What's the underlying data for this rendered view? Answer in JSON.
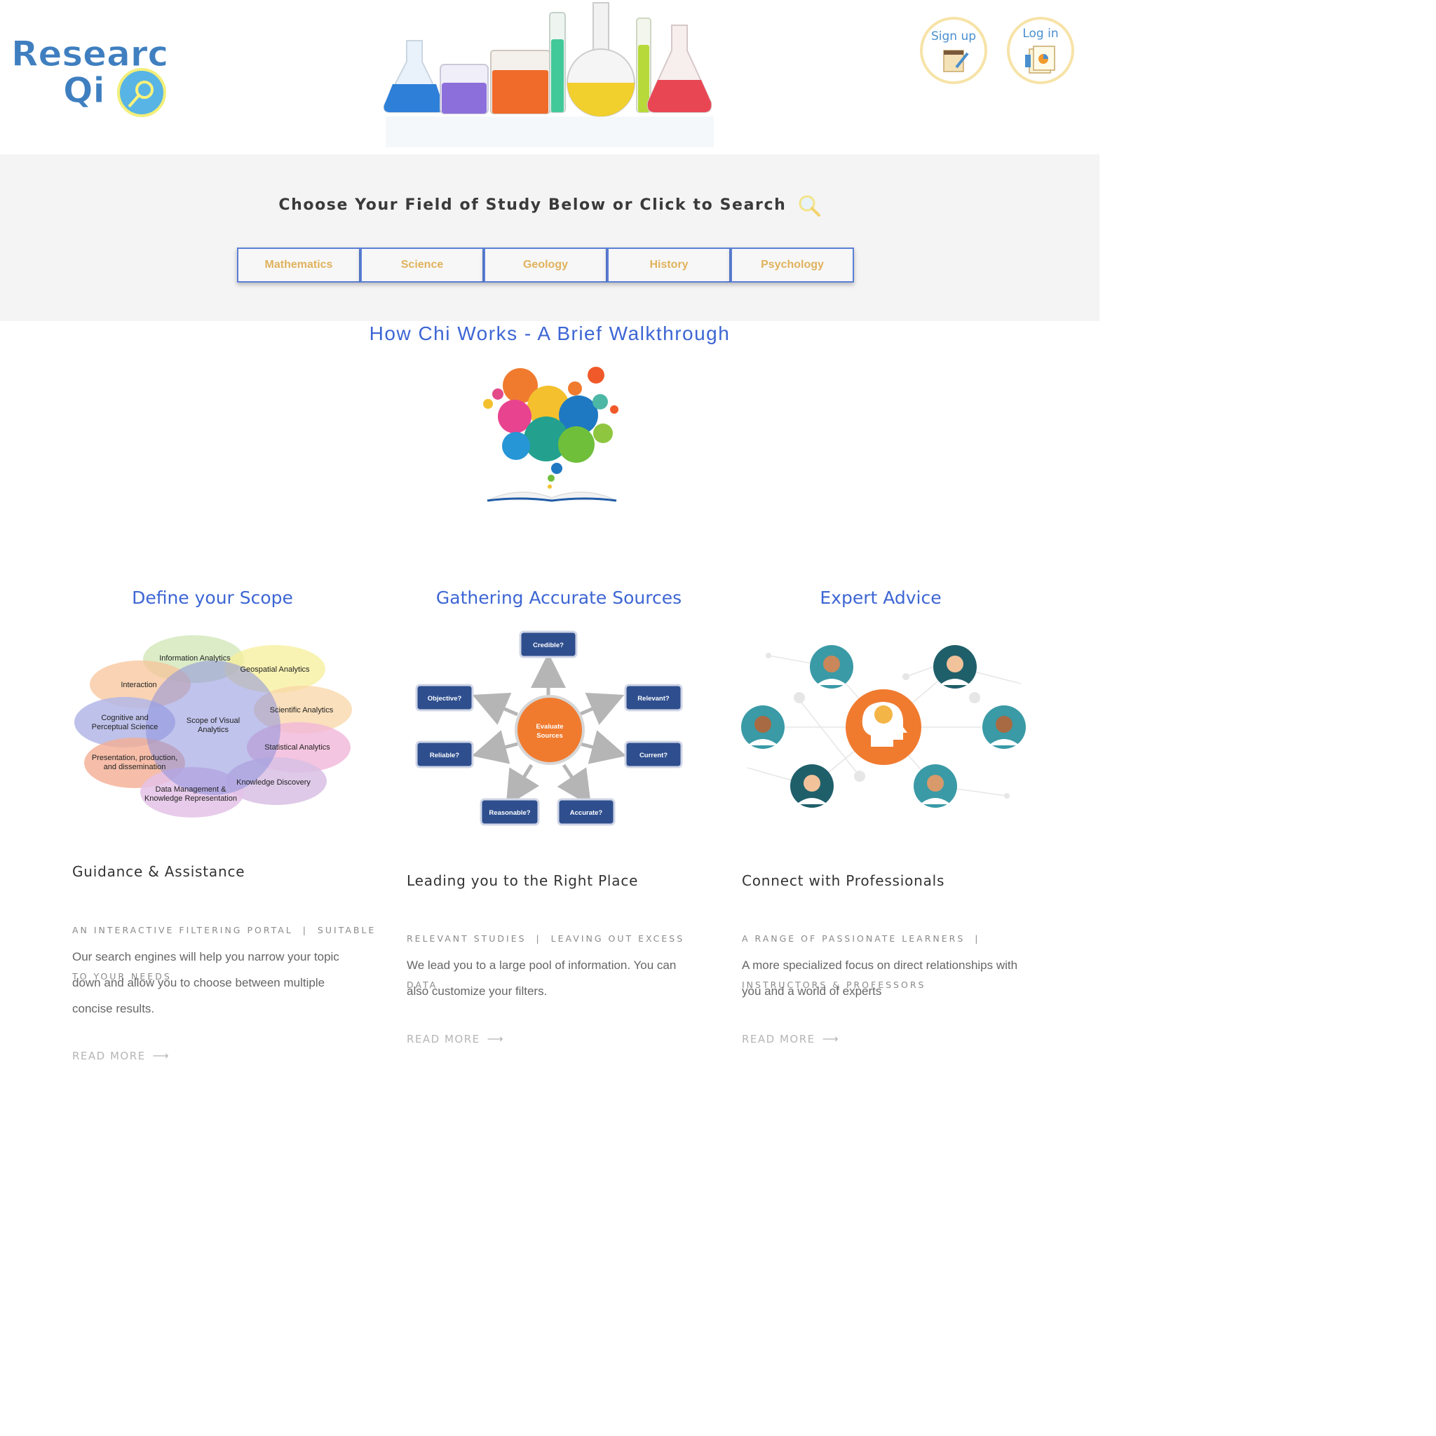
{
  "brand": {
    "line1": "Research",
    "line2": "Qi"
  },
  "auth": {
    "signup_label": "Sign up",
    "login_label": "Log in"
  },
  "field_section": {
    "heading": "Choose Your Field of Study Below or Click to Search",
    "fields": [
      "Mathematics",
      "Science",
      "Geology",
      "History",
      "Psychology"
    ]
  },
  "walkthrough": {
    "title": "How Chi Works - A Brief Walkthrough"
  },
  "features": [
    {
      "title": "Define your Scope",
      "heading": "Guidance & Assistance",
      "tags_line1": "AN INTERACTIVE FILTERING PORTAL  |  SUITABLE",
      "tags_line2": "TO YOUR NEEDS",
      "desc_lines": [
        "Our search engines will help you narrow your topic",
        "down and allow you to choose between multiple",
        "concise results."
      ],
      "read_more": "READ MORE",
      "diagram": {
        "center": [
          "Scope of Visual",
          "Analytics"
        ],
        "petals": [
          "Information Analytics",
          "Geospatial Analytics",
          "Interaction",
          "Scientific Analytics",
          "Cognitive and",
          "Perceptual Science",
          "Statistical Analytics",
          "Presentation, production,",
          "and dissemination",
          "Knowledge Discovery",
          "Data Management &",
          "Knowledge Representation"
        ]
      }
    },
    {
      "title": "Gathering Accurate Sources",
      "heading": "Leading you to the Right Place",
      "tags_line1": "RELEVANT STUDIES  |  LEAVING OUT EXCESS",
      "tags_line2": "DATA",
      "desc_lines": [
        "We lead you to a large pool of information. You can",
        "also customize your filters."
      ],
      "read_more": "READ MORE",
      "diagram": {
        "center": [
          "Evaluate",
          "Sources"
        ],
        "boxes": [
          "Credible?",
          "Objective?",
          "Relevant?",
          "Reliable?",
          "Current?",
          "Reasonable?",
          "Accurate?"
        ]
      }
    },
    {
      "title": "Expert Advice",
      "heading": "Connect with Professionals",
      "tags_line1": "A RANGE OF PASSIONATE LEARNERS  |",
      "tags_line2": "INSTRUCTORS & PROFESSORS",
      "desc_lines": [
        "A more specialized focus on direct relationships with",
        "you and a world of experts"
      ],
      "read_more": "READ MORE"
    }
  ],
  "colors": {
    "accent_blue": "#3d66d4",
    "button_text": "#e0b25c",
    "button_border": "#5b7fd6",
    "band_bg": "#f4f4f4",
    "orange": "#f07b2f"
  }
}
